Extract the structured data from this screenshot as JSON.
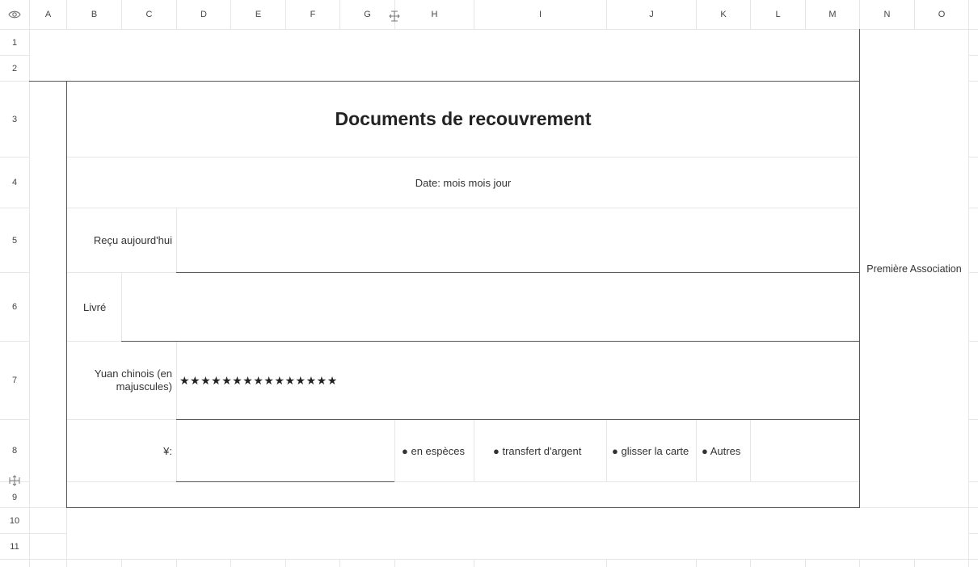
{
  "columns": [
    "A",
    "B",
    "C",
    "D",
    "E",
    "F",
    "G",
    "H",
    "I",
    "J",
    "K",
    "L",
    "M",
    "N",
    "O"
  ],
  "rows": [
    "1",
    "2",
    "3",
    "4",
    "5",
    "6",
    "7",
    "8",
    "9",
    "10",
    "11"
  ],
  "form": {
    "title": "Documents de recouvrement",
    "date_line": "Date: mois mois jour",
    "received_label": "Reçu aujourd'hui",
    "delivered_label": "Livré",
    "yuan_label": "Yuan chinois (en majuscules)",
    "stars": "★★★★★★★★★★★★★★★",
    "yen_label": "¥:",
    "options": [
      "● en espèces",
      "● transfert d'argent",
      "● glisser la carte",
      "● Autres"
    ],
    "side_label": "Première Association"
  },
  "icons": {
    "corner": "eye-icon",
    "col_resize": "column-resize-icon",
    "row_resize": "row-resize-icon"
  }
}
